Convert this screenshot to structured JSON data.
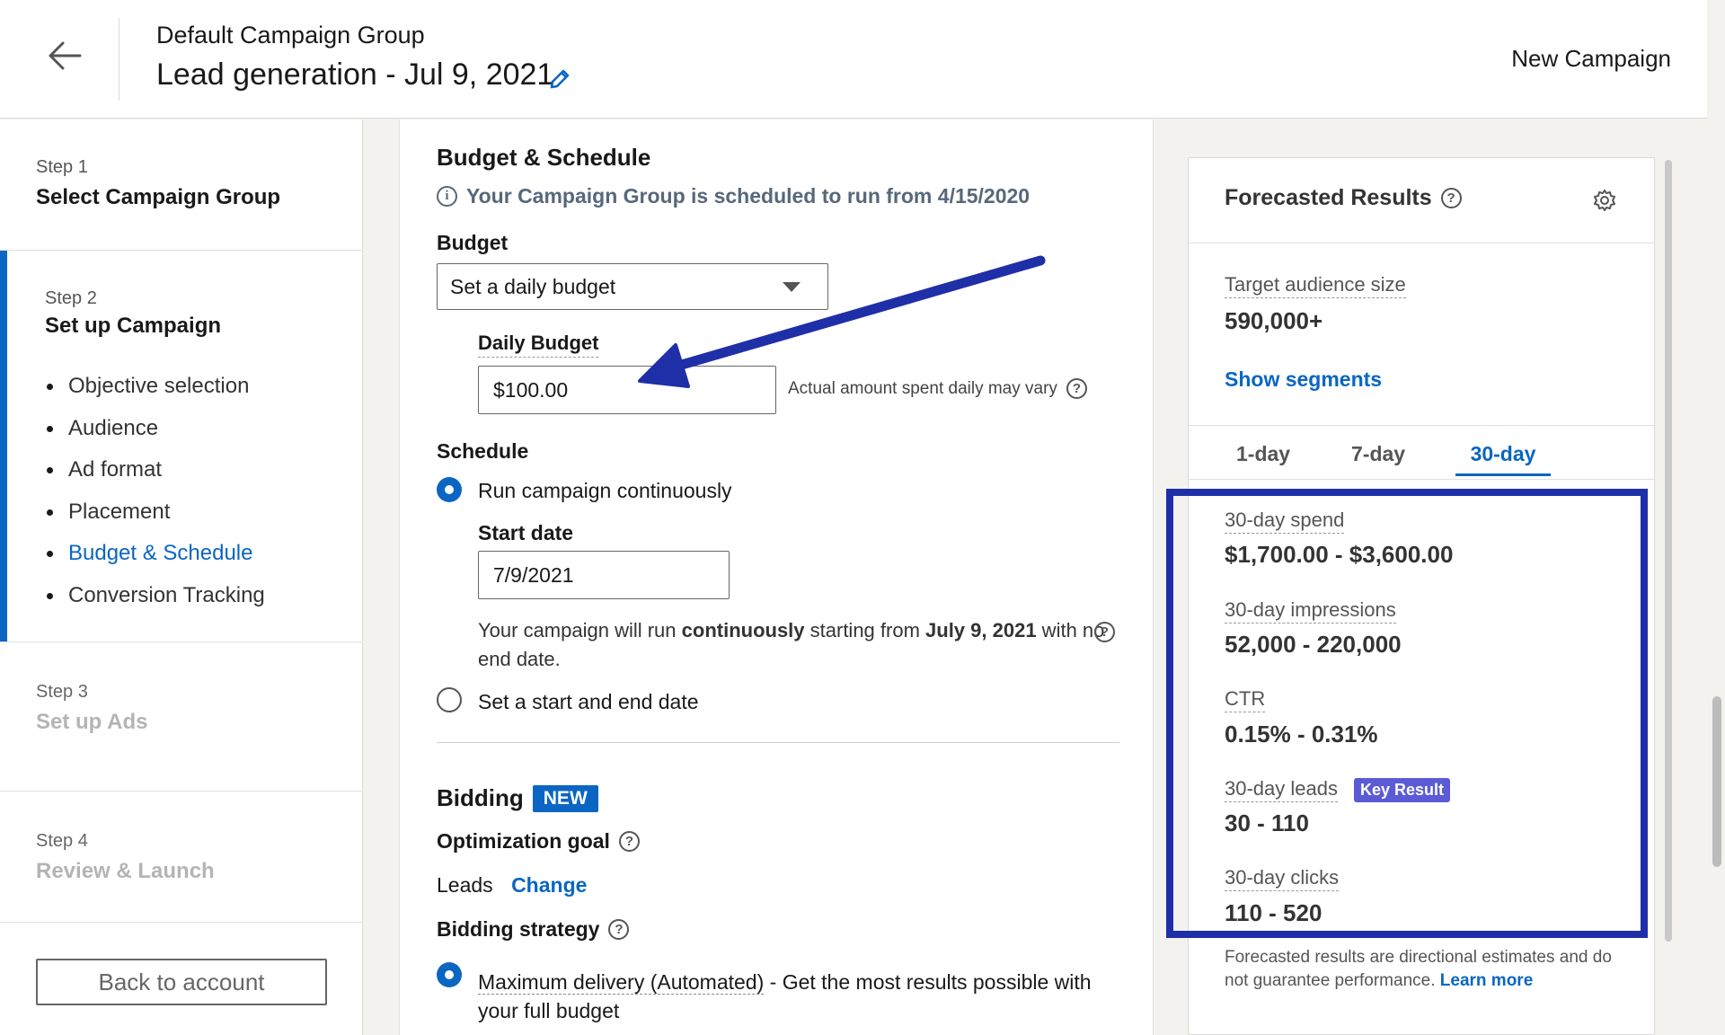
{
  "header": {
    "group_name": "Default Campaign Group",
    "campaign_name": "Lead generation - Jul 9, 2021",
    "new_campaign": "New Campaign"
  },
  "steps": [
    {
      "num": "Step 1",
      "title": "Select Campaign Group"
    },
    {
      "num": "Step 2",
      "title": "Set up Campaign",
      "substeps": [
        "Objective selection",
        "Audience",
        "Ad format",
        "Placement",
        "Budget & Schedule",
        "Conversion Tracking"
      ],
      "active_substep": "Budget & Schedule"
    },
    {
      "num": "Step 3",
      "title": "Set up Ads"
    },
    {
      "num": "Step 4",
      "title": "Review & Launch"
    }
  ],
  "back_to_account": "Back to account",
  "budget": {
    "section_title": "Budget & Schedule",
    "info": "Your Campaign Group is scheduled to run from 4/15/2020",
    "budget_label": "Budget",
    "budget_type": "Set a daily budget",
    "daily_budget_label": "Daily Budget",
    "daily_budget_value": "$100.00",
    "daily_hint": "Actual amount spent daily may vary"
  },
  "schedule": {
    "label": "Schedule",
    "option_continuous": "Run campaign continuously",
    "start_date_label": "Start date",
    "start_date_value": "7/9/2021",
    "desc_1": "Your campaign will run ",
    "desc_bold_1": "continuously",
    "desc_2": " starting from ",
    "desc_bold_2": "July 9, 2021",
    "desc_3": " with no end date.",
    "option_start_end": "Set a start and end date"
  },
  "bidding": {
    "title": "Bidding",
    "badge": "NEW",
    "goal_label": "Optimization goal",
    "goal_value": "Leads",
    "change_link": "Change",
    "strategy_label": "Bidding strategy",
    "strategy_option": "Maximum delivery (Automated)",
    "strategy_desc": " - Get the most results possible with your full budget"
  },
  "forecast": {
    "title": "Forecasted Results",
    "audience_label": "Target audience size",
    "audience_value": "590,000+",
    "show_segments": "Show segments",
    "tabs": [
      "1-day",
      "7-day",
      "30-day"
    ],
    "active_tab": "30-day",
    "metrics": [
      {
        "label": "30-day spend",
        "value": "$1,700.00 - $3,600.00"
      },
      {
        "label": "30-day impressions",
        "value": "52,000 - 220,000"
      },
      {
        "label": "CTR",
        "value": "0.15% - 0.31%"
      },
      {
        "label": "30-day leads",
        "value": "30 - 110",
        "badge": "Key Result"
      },
      {
        "label": "30-day clicks",
        "value": "110 - 520"
      }
    ],
    "disclaimer": "Forecasted results are directional estimates and do not guarantee performance.",
    "learn_more": "Learn more"
  },
  "colors": {
    "accent": "#0a66c2",
    "highlight": "#1f2fa8",
    "key_result": "#5b5bd6"
  }
}
